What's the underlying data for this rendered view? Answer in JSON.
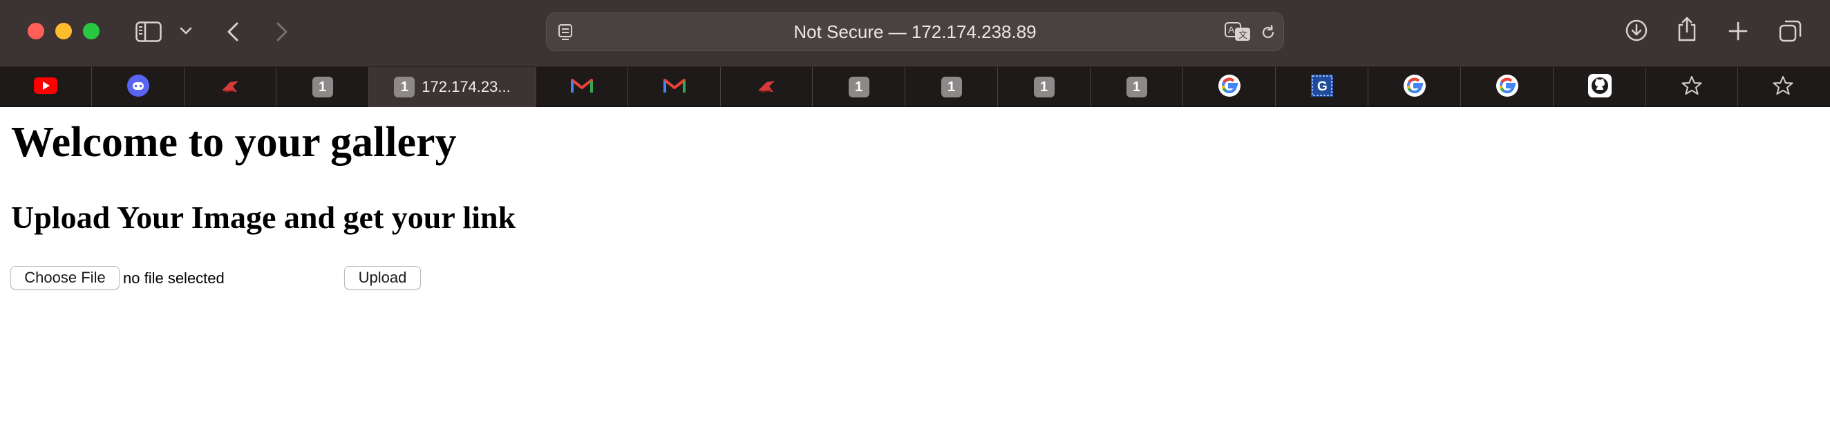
{
  "browser": {
    "address": "Not Secure — 172.174.238.89",
    "colors": {
      "close": "#ff5f57",
      "minimize": "#febc2e",
      "zoom": "#28c840",
      "toolbar": "#3c3333",
      "tabbar": "#1f1a1a"
    }
  },
  "tabs": [
    {
      "icon": "youtube-icon",
      "label": ""
    },
    {
      "icon": "discord-icon",
      "label": ""
    },
    {
      "icon": "red-bird-icon",
      "label": ""
    },
    {
      "icon": "number-badge-icon",
      "badge": "1",
      "label": ""
    },
    {
      "icon": "number-badge-icon",
      "badge": "1",
      "label": "172.174.23...",
      "active": true
    },
    {
      "icon": "gmail-icon",
      "label": ""
    },
    {
      "icon": "gmail-icon",
      "label": ""
    },
    {
      "icon": "red-bird-icon",
      "label": ""
    },
    {
      "icon": "number-badge-icon",
      "badge": "1",
      "label": ""
    },
    {
      "icon": "number-badge-icon",
      "badge": "1",
      "label": ""
    },
    {
      "icon": "number-badge-icon",
      "badge": "1",
      "label": ""
    },
    {
      "icon": "number-badge-icon",
      "badge": "1",
      "label": ""
    },
    {
      "icon": "google-icon",
      "label": ""
    },
    {
      "icon": "blue-square-g-icon",
      "label": ""
    },
    {
      "icon": "google-icon",
      "label": ""
    },
    {
      "icon": "google-icon",
      "label": ""
    },
    {
      "icon": "github-icon",
      "label": ""
    },
    {
      "icon": "star-icon",
      "label": ""
    },
    {
      "icon": "star-icon",
      "label": ""
    }
  ],
  "page": {
    "heading": "Welcome to your gallery",
    "subheading": "Upload Your Image and get your link",
    "choose_file_label": "Choose File",
    "file_status": "no file selected",
    "upload_label": "Upload"
  }
}
